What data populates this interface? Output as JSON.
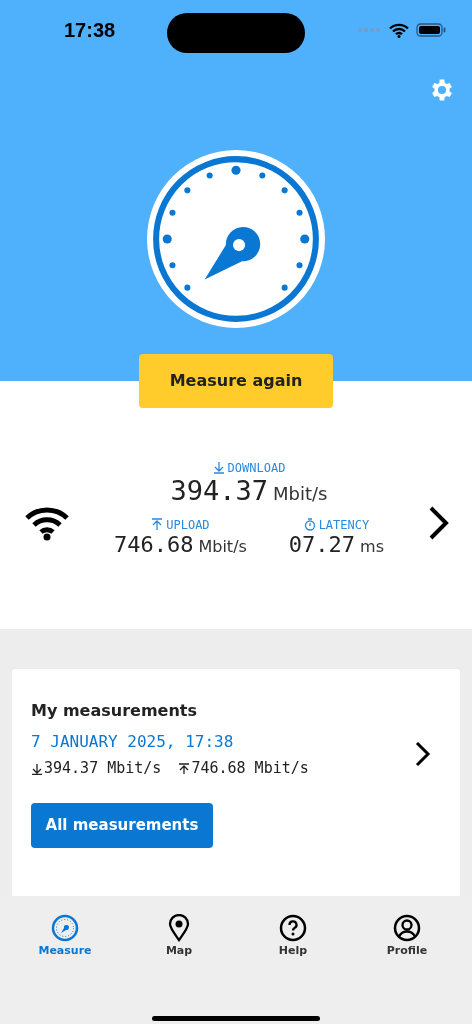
{
  "status_bar": {
    "time": "17:38"
  },
  "measure_button": "Measure again",
  "results": {
    "download": {
      "label": "DOWNLOAD",
      "value": "394.37",
      "unit": "Mbit/s"
    },
    "upload": {
      "label": "UPLOAD",
      "value": "746.68",
      "unit": "Mbit/s"
    },
    "latency": {
      "label": "LATENCY",
      "value": "07.27",
      "unit": "ms"
    }
  },
  "my_measurements": {
    "title": "My measurements",
    "date": "7 JANUARY 2025, 17:38",
    "download": "394.37 Mbit/s",
    "upload": "746.68 Mbit/s",
    "button": "All measurements"
  },
  "tab_bar": [
    {
      "kind": "measure",
      "label": "Measure",
      "selected": true
    },
    {
      "kind": "map",
      "label": "Map",
      "selected": false
    },
    {
      "kind": "help",
      "label": "Help",
      "selected": false
    },
    {
      "kind": "profile",
      "label": "Profile",
      "selected": false
    }
  ]
}
